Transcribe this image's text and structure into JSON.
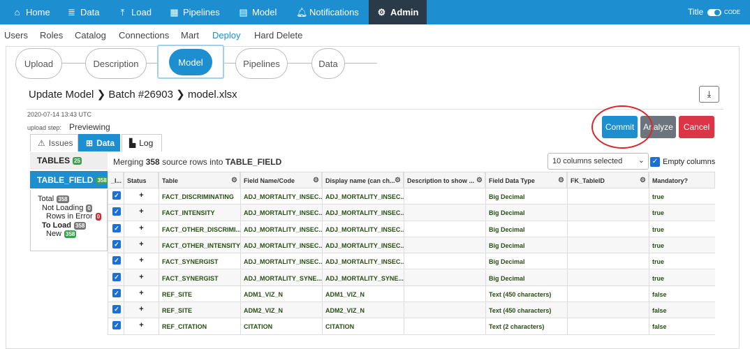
{
  "nav": {
    "items": [
      {
        "label": "Home",
        "icon": "home-icon"
      },
      {
        "label": "Data",
        "icon": "database-icon"
      },
      {
        "label": "Load",
        "icon": "upload-icon"
      },
      {
        "label": "Pipelines",
        "icon": "pipelines-icon"
      },
      {
        "label": "Model",
        "icon": "model-icon"
      },
      {
        "label": "Notifications",
        "icon": "bell-icon"
      },
      {
        "label": "Admin",
        "icon": "gear-icon"
      }
    ],
    "toggle_left": "Title",
    "toggle_right": "CODE"
  },
  "subnav": [
    "Users",
    "Roles",
    "Catalog",
    "Connections",
    "Mart",
    "Deploy",
    "Hard Delete"
  ],
  "steps": [
    "Upload",
    "Description",
    "Model",
    "Pipelines",
    "Data"
  ],
  "header": {
    "title": "Update Model",
    "batch": "Batch #26903",
    "file": "model.xlsx"
  },
  "meta": {
    "date": "2020-07-14 13:43 UTC",
    "step_label": "upload step:",
    "step_value": "Previewing"
  },
  "actions": {
    "commit": "Commit",
    "analyze": "Analyze",
    "cancel": "Cancel"
  },
  "tabs": {
    "issues": "Issues",
    "data": "Data",
    "log": "Log"
  },
  "sidebar": {
    "tables_label": "TABLES",
    "tables_count": "25",
    "item_label": "TABLE_FIELD",
    "item_count": "358",
    "stats": [
      {
        "label": "Total",
        "count": "358"
      },
      {
        "label": "Not Loading",
        "count": "0"
      },
      {
        "label": "Rows in Error",
        "count": "0"
      },
      {
        "label": "To Load",
        "count": "358"
      },
      {
        "label": "New",
        "count": "358"
      }
    ]
  },
  "info": {
    "prefix": "Merging",
    "count": "358",
    "middle": "source rows into",
    "table": "TABLE_FIELD"
  },
  "columns_select": "10 columns selected",
  "empty_columns": "Empty columns",
  "table": {
    "columns": [
      "_I...",
      "Status",
      "Table",
      "Field Name/Code",
      "Display name (can ch...",
      "Description to show ...",
      "Field Data Type",
      "FK_TableID",
      "Mandatory?"
    ],
    "rows": [
      {
        "status": "+",
        "table": "FACT_DISCRIMINATING",
        "field": "ADJ_MORTALITY_INSEC...",
        "display": "ADJ_MORTALITY_INSEC...",
        "desc": "",
        "type": "Big Decimal",
        "fk": "",
        "mandatory": "true"
      },
      {
        "status": "+",
        "table": "FACT_INTENSITY",
        "field": "ADJ_MORTALITY_INSEC...",
        "display": "ADJ_MORTALITY_INSEC...",
        "desc": "",
        "type": "Big Decimal",
        "fk": "",
        "mandatory": "true"
      },
      {
        "status": "+",
        "table": "FACT_OTHER_DISCRIMI...",
        "field": "ADJ_MORTALITY_INSEC...",
        "display": "ADJ_MORTALITY_INSEC...",
        "desc": "",
        "type": "Big Decimal",
        "fk": "",
        "mandatory": "true"
      },
      {
        "status": "+",
        "table": "FACT_OTHER_INTENSITY",
        "field": "ADJ_MORTALITY_INSEC...",
        "display": "ADJ_MORTALITY_INSEC...",
        "desc": "",
        "type": "Big Decimal",
        "fk": "",
        "mandatory": "true"
      },
      {
        "status": "+",
        "table": "FACT_SYNERGIST",
        "field": "ADJ_MORTALITY_INSEC...",
        "display": "ADJ_MORTALITY_INSEC...",
        "desc": "",
        "type": "Big Decimal",
        "fk": "",
        "mandatory": "true"
      },
      {
        "status": "+",
        "table": "FACT_SYNERGIST",
        "field": "ADJ_MORTALITY_SYNE...",
        "display": "ADJ_MORTALITY_SYNE...",
        "desc": "",
        "type": "Big Decimal",
        "fk": "",
        "mandatory": "true"
      },
      {
        "status": "+",
        "table": "REF_SITE",
        "field": "ADM1_VIZ_N",
        "display": "ADM1_VIZ_N",
        "desc": "",
        "type": "Text (450 characters)",
        "fk": "",
        "mandatory": "false"
      },
      {
        "status": "+",
        "table": "REF_SITE",
        "field": "ADM2_VIZ_N",
        "display": "ADM2_VIZ_N",
        "desc": "",
        "type": "Text (450 characters)",
        "fk": "",
        "mandatory": "false"
      },
      {
        "status": "+",
        "table": "REF_CITATION",
        "field": "CITATION",
        "display": "CITATION",
        "desc": "",
        "type": "Text (2 characters)",
        "fk": "",
        "mandatory": "false"
      }
    ]
  }
}
